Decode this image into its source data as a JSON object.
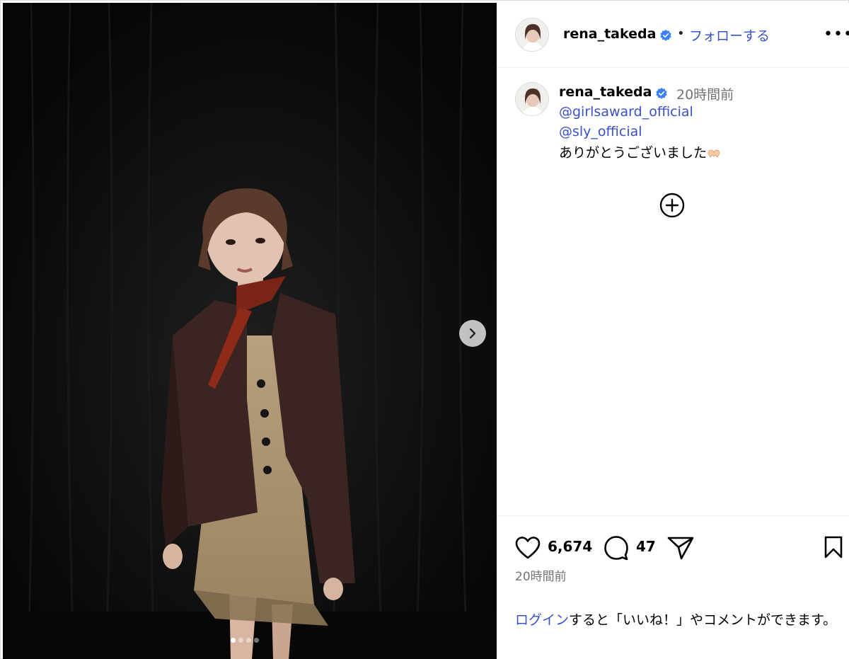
{
  "post": {
    "username": "rena_takeda",
    "follow_label": "フォローする",
    "separator": "•",
    "more_label": "•••",
    "caption": {
      "username": "rena_takeda",
      "time": "20時間前",
      "mentions": [
        "@girlsaward_official",
        "@sly_official"
      ],
      "text": "ありがとうございました"
    },
    "likes": "6,674",
    "comments": "47",
    "timestamp": "20時間前",
    "login_link": "ログイン",
    "login_text": "すると「いいね！」やコメントができます。"
  },
  "carousel": {
    "total_slides": 4,
    "active_slide": 1
  },
  "icons": {
    "verified": "verified-badge-icon",
    "like": "heart-icon",
    "comment": "comment-bubble-icon",
    "share": "paper-plane-icon",
    "save": "bookmark-icon",
    "expand": "plus-circle-icon",
    "next": "chevron-right-icon"
  },
  "colors": {
    "link": "#3a50c9",
    "verified": "#3b82f6",
    "muted": "#737373",
    "photo_bg": "#0c0c0c"
  }
}
